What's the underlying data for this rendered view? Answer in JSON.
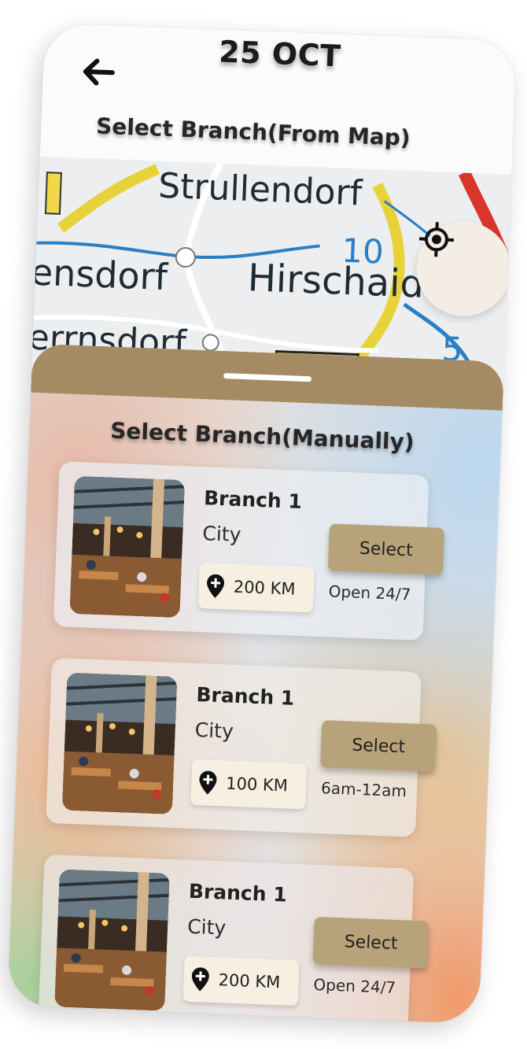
{
  "header": {
    "date": "25 OCT"
  },
  "map_section": {
    "title": "Select Branch(From Map)",
    "labels": [
      "Strullendorf",
      "ensdorf",
      "Hirschaid",
      "errnsdorf",
      "10",
      "5"
    ]
  },
  "manual_section": {
    "title": "Select Branch(Manually)"
  },
  "branches": [
    {
      "name": "Branch 1",
      "city": "City",
      "distance": "200 KM",
      "hours": "Open 24/7",
      "select_label": "Select"
    },
    {
      "name": "Branch 1",
      "city": "City",
      "distance": "100 KM",
      "hours": "6am-12am",
      "select_label": "Select"
    },
    {
      "name": "Branch 1",
      "city": "City",
      "distance": "200 KM",
      "hours": "Open 24/7",
      "select_label": "Select"
    }
  ],
  "icons": {
    "back": "arrow-left-icon",
    "locate": "crosshair-icon",
    "distance": "location-pin-plus-icon"
  },
  "colors": {
    "accent": "#a48b63",
    "button": "#b8a27a",
    "chip": "#f6efe2",
    "locate_bg": "#f3ede4"
  }
}
